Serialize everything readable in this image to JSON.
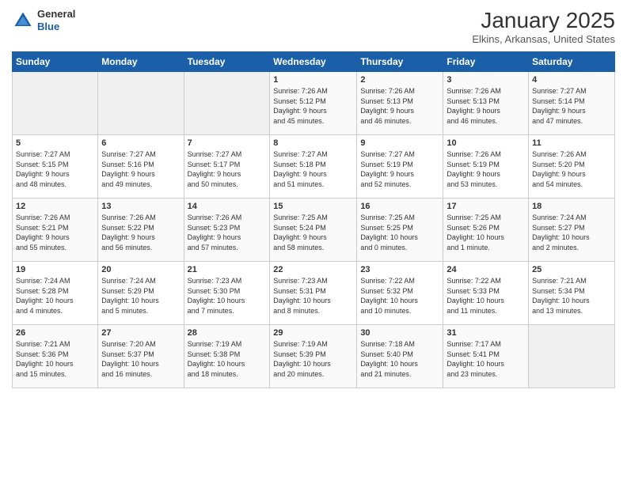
{
  "logo": {
    "general": "General",
    "blue": "Blue"
  },
  "title": "January 2025",
  "location": "Elkins, Arkansas, United States",
  "days_of_week": [
    "Sunday",
    "Monday",
    "Tuesday",
    "Wednesday",
    "Thursday",
    "Friday",
    "Saturday"
  ],
  "weeks": [
    [
      {
        "day": "",
        "info": ""
      },
      {
        "day": "",
        "info": ""
      },
      {
        "day": "",
        "info": ""
      },
      {
        "day": "1",
        "info": "Sunrise: 7:26 AM\nSunset: 5:12 PM\nDaylight: 9 hours\nand 45 minutes."
      },
      {
        "day": "2",
        "info": "Sunrise: 7:26 AM\nSunset: 5:13 PM\nDaylight: 9 hours\nand 46 minutes."
      },
      {
        "day": "3",
        "info": "Sunrise: 7:26 AM\nSunset: 5:13 PM\nDaylight: 9 hours\nand 46 minutes."
      },
      {
        "day": "4",
        "info": "Sunrise: 7:27 AM\nSunset: 5:14 PM\nDaylight: 9 hours\nand 47 minutes."
      }
    ],
    [
      {
        "day": "5",
        "info": "Sunrise: 7:27 AM\nSunset: 5:15 PM\nDaylight: 9 hours\nand 48 minutes."
      },
      {
        "day": "6",
        "info": "Sunrise: 7:27 AM\nSunset: 5:16 PM\nDaylight: 9 hours\nand 49 minutes."
      },
      {
        "day": "7",
        "info": "Sunrise: 7:27 AM\nSunset: 5:17 PM\nDaylight: 9 hours\nand 50 minutes."
      },
      {
        "day": "8",
        "info": "Sunrise: 7:27 AM\nSunset: 5:18 PM\nDaylight: 9 hours\nand 51 minutes."
      },
      {
        "day": "9",
        "info": "Sunrise: 7:27 AM\nSunset: 5:19 PM\nDaylight: 9 hours\nand 52 minutes."
      },
      {
        "day": "10",
        "info": "Sunrise: 7:26 AM\nSunset: 5:19 PM\nDaylight: 9 hours\nand 53 minutes."
      },
      {
        "day": "11",
        "info": "Sunrise: 7:26 AM\nSunset: 5:20 PM\nDaylight: 9 hours\nand 54 minutes."
      }
    ],
    [
      {
        "day": "12",
        "info": "Sunrise: 7:26 AM\nSunset: 5:21 PM\nDaylight: 9 hours\nand 55 minutes."
      },
      {
        "day": "13",
        "info": "Sunrise: 7:26 AM\nSunset: 5:22 PM\nDaylight: 9 hours\nand 56 minutes."
      },
      {
        "day": "14",
        "info": "Sunrise: 7:26 AM\nSunset: 5:23 PM\nDaylight: 9 hours\nand 57 minutes."
      },
      {
        "day": "15",
        "info": "Sunrise: 7:25 AM\nSunset: 5:24 PM\nDaylight: 9 hours\nand 58 minutes."
      },
      {
        "day": "16",
        "info": "Sunrise: 7:25 AM\nSunset: 5:25 PM\nDaylight: 10 hours\nand 0 minutes."
      },
      {
        "day": "17",
        "info": "Sunrise: 7:25 AM\nSunset: 5:26 PM\nDaylight: 10 hours\nand 1 minute."
      },
      {
        "day": "18",
        "info": "Sunrise: 7:24 AM\nSunset: 5:27 PM\nDaylight: 10 hours\nand 2 minutes."
      }
    ],
    [
      {
        "day": "19",
        "info": "Sunrise: 7:24 AM\nSunset: 5:28 PM\nDaylight: 10 hours\nand 4 minutes."
      },
      {
        "day": "20",
        "info": "Sunrise: 7:24 AM\nSunset: 5:29 PM\nDaylight: 10 hours\nand 5 minutes."
      },
      {
        "day": "21",
        "info": "Sunrise: 7:23 AM\nSunset: 5:30 PM\nDaylight: 10 hours\nand 7 minutes."
      },
      {
        "day": "22",
        "info": "Sunrise: 7:23 AM\nSunset: 5:31 PM\nDaylight: 10 hours\nand 8 minutes."
      },
      {
        "day": "23",
        "info": "Sunrise: 7:22 AM\nSunset: 5:32 PM\nDaylight: 10 hours\nand 10 minutes."
      },
      {
        "day": "24",
        "info": "Sunrise: 7:22 AM\nSunset: 5:33 PM\nDaylight: 10 hours\nand 11 minutes."
      },
      {
        "day": "25",
        "info": "Sunrise: 7:21 AM\nSunset: 5:34 PM\nDaylight: 10 hours\nand 13 minutes."
      }
    ],
    [
      {
        "day": "26",
        "info": "Sunrise: 7:21 AM\nSunset: 5:36 PM\nDaylight: 10 hours\nand 15 minutes."
      },
      {
        "day": "27",
        "info": "Sunrise: 7:20 AM\nSunset: 5:37 PM\nDaylight: 10 hours\nand 16 minutes."
      },
      {
        "day": "28",
        "info": "Sunrise: 7:19 AM\nSunset: 5:38 PM\nDaylight: 10 hours\nand 18 minutes."
      },
      {
        "day": "29",
        "info": "Sunrise: 7:19 AM\nSunset: 5:39 PM\nDaylight: 10 hours\nand 20 minutes."
      },
      {
        "day": "30",
        "info": "Sunrise: 7:18 AM\nSunset: 5:40 PM\nDaylight: 10 hours\nand 21 minutes."
      },
      {
        "day": "31",
        "info": "Sunrise: 7:17 AM\nSunset: 5:41 PM\nDaylight: 10 hours\nand 23 minutes."
      },
      {
        "day": "",
        "info": ""
      }
    ]
  ]
}
